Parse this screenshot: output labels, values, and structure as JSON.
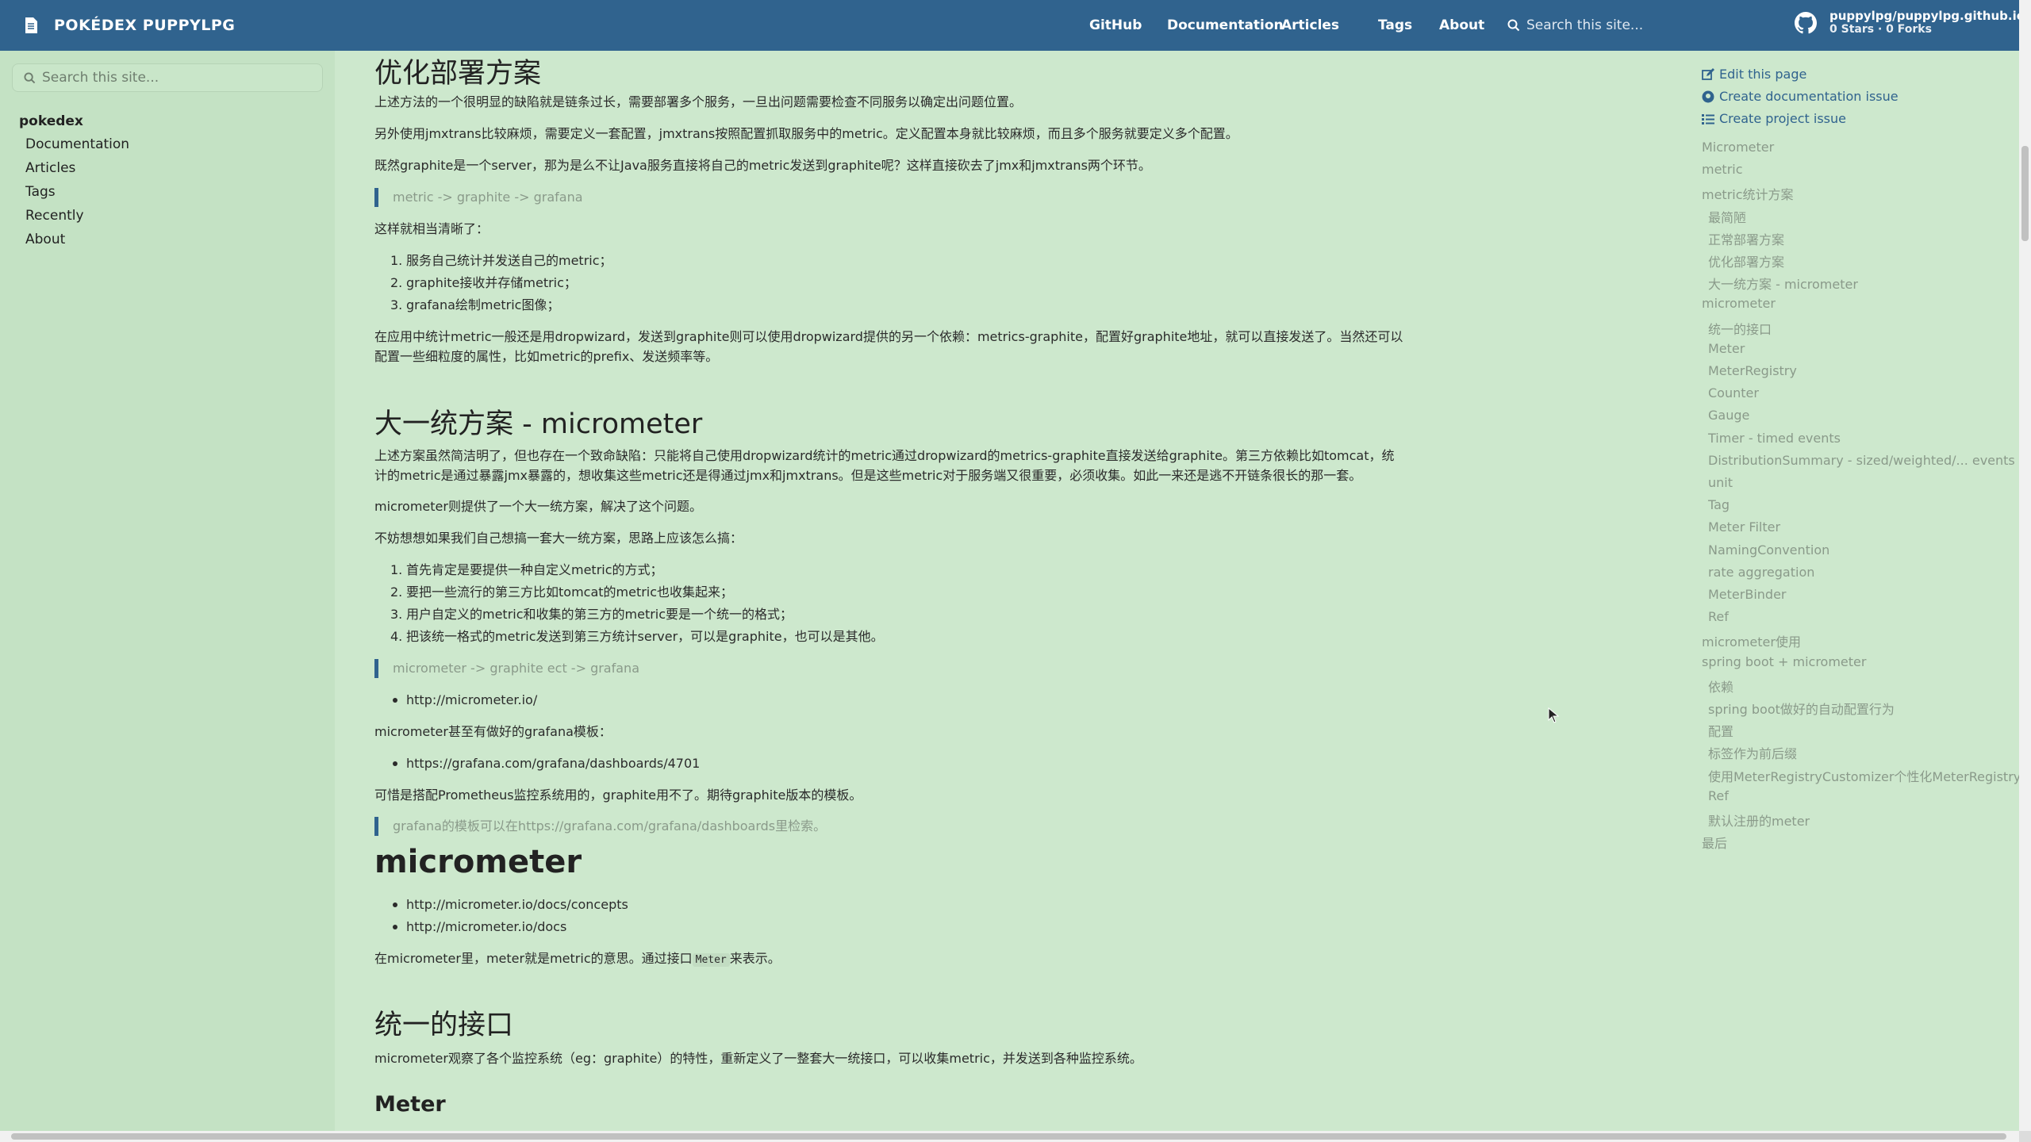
{
  "topnav": {
    "brand": "POKÉDEX PUPPYLPG",
    "links": [
      "GitHub",
      "Documentation",
      "Articles",
      "Tags",
      "About"
    ],
    "search_placeholder": "Search this site...",
    "repo_name": "puppylpg/puppylpg.github.io",
    "repo_stats": "0 Stars · 0 Forks"
  },
  "sidebar": {
    "search_placeholder": "Search this site...",
    "root": "pokedex",
    "items": [
      "Documentation",
      "Articles",
      "Tags",
      "Recently",
      "About"
    ]
  },
  "content": {
    "h_opt": "优化部署方案",
    "p1": "上述方法的一个很明显的缺陷就是链条过长，需要部署多个服务，一旦出问题需要检查不同服务以确定出问题位置。",
    "p2": "另外使用jmxtrans比较麻烦，需要定义一套配置，jmxtrans按照配置抓取服务中的metric。定义配置本身就比较麻烦，而且多个服务就要定义多个配置。",
    "p3": "既然graphite是一个server，那为是么不让Java服务直接将自己的metric发送到graphite呢？这样直接砍去了jmx和jmxtrans两个环节。",
    "q1": "metric -> graphite -> grafana",
    "p4": "这样就相当清晰了：",
    "list1": [
      "服务自己统计并发送自己的metric；",
      "graphite接收并存储metric；",
      "grafana绘制metric图像；"
    ],
    "p5": "在应用中统计metric一般还是用dropwizard，发送到graphite则可以使用dropwizard提供的另一个依赖：metrics-graphite，配置好graphite地址，就可以直接发送了。当然还可以配置一些细粒度的属性，比如metric的prefix、发送频率等。",
    "h_unify": "大一统方案 - micrometer",
    "p6": "上述方案虽然简洁明了，但也存在一个致命缺陷：只能将自己使用dropwizard统计的metric通过dropwizard的metrics-graphite直接发送给graphite。第三方依赖比如tomcat，统计的metric是通过暴露jmx暴露的，想收集这些metric还是得通过jmx和jmxtrans。但是这些metric对于服务端又很重要，必须收集。如此一来还是逃不开链条很长的那一套。",
    "p7": "micrometer则提供了一个大一统方案，解决了这个问题。",
    "p8": "不妨想想如果我们自己想搞一套大一统方案，思路上应该怎么搞：",
    "list2": [
      "首先肯定是要提供一种自定义metric的方式；",
      "要把一些流行的第三方比如tomcat的metric也收集起来；",
      "用户自定义的metric和收集的第三方的metric要是一个统一的格式；",
      "把该统一格式的metric发送到第三方统计server，可以是graphite，也可以是其他。"
    ],
    "q2": "micrometer -> graphite ect -> grafana",
    "link1": "http://micrometer.io/",
    "p9": "micrometer甚至有做好的grafana模板：",
    "link2": "https://grafana.com/grafana/dashboards/4701",
    "p10": "可惜是搭配Prometheus监控系统用的，graphite用不了。期待graphite版本的模板。",
    "q3": "grafana的模板可以在https://grafana.com/grafana/dashboards里检索。",
    "h_micrometer": "micrometer",
    "link3": "http://micrometer.io/docs/concepts",
    "link4": "http://micrometer.io/docs",
    "p11_a": "在micrometer里，meter就是metric的意思。通过接口",
    "p11_code": "Meter",
    "p11_b": "来表示。",
    "h_iface": "统一的接口",
    "p12": "micrometer观察了各个监控系统（eg：graphite）的特性，重新定义了一整套大一统接口，可以收集metric，并发送到各种监控系统。",
    "h_meter": "Meter"
  },
  "toc": {
    "edit": "Edit this page",
    "doc_issue": "Create documentation issue",
    "proj_issue": "Create project issue",
    "items": [
      {
        "t": "Micrometer",
        "lv": 0
      },
      {
        "t": "metric",
        "lv": 0
      },
      {
        "t": "metric统计方案",
        "lv": 0
      },
      {
        "t": "最简陋",
        "lv": 1
      },
      {
        "t": "正常部署方案",
        "lv": 1
      },
      {
        "t": "优化部署方案",
        "lv": 1
      },
      {
        "t": "大一统方案 - micrometer",
        "lv": 1
      },
      {
        "t": "micrometer",
        "lv": 0
      },
      {
        "t": "统一的接口",
        "lv": 1
      },
      {
        "t": "Meter",
        "lv": 1
      },
      {
        "t": "MeterRegistry",
        "lv": 1
      },
      {
        "t": "Counter",
        "lv": 1
      },
      {
        "t": "Gauge",
        "lv": 1
      },
      {
        "t": "Timer - timed events",
        "lv": 1
      },
      {
        "t": "DistributionSummary - sized/weighted/... events",
        "lv": 1
      },
      {
        "t": "unit",
        "lv": 1
      },
      {
        "t": "Tag",
        "lv": 1
      },
      {
        "t": "Meter Filter",
        "lv": 1
      },
      {
        "t": "NamingConvention",
        "lv": 1
      },
      {
        "t": "rate aggregation",
        "lv": 1
      },
      {
        "t": "MeterBinder",
        "lv": 1
      },
      {
        "t": "Ref",
        "lv": 1
      },
      {
        "t": "micrometer使用",
        "lv": 0
      },
      {
        "t": "spring boot + micrometer",
        "lv": 0
      },
      {
        "t": "依赖",
        "lv": 1
      },
      {
        "t": "spring boot做好的自动配置行为",
        "lv": 1
      },
      {
        "t": "配置",
        "lv": 1
      },
      {
        "t": "标签作为前后缀",
        "lv": 1
      },
      {
        "t": "使用MeterRegistryCustomizer个性化MeterRegistry",
        "lv": 1
      },
      {
        "t": "Ref",
        "lv": 1
      },
      {
        "t": "默认注册的meter",
        "lv": 1
      },
      {
        "t": "最后",
        "lv": 0
      }
    ]
  },
  "colors": {
    "nav": "#30638e",
    "page_bg": "#cde8cd",
    "sidebar_bg": "#c4e2c4",
    "toc_muted": "#8a9a8a"
  }
}
